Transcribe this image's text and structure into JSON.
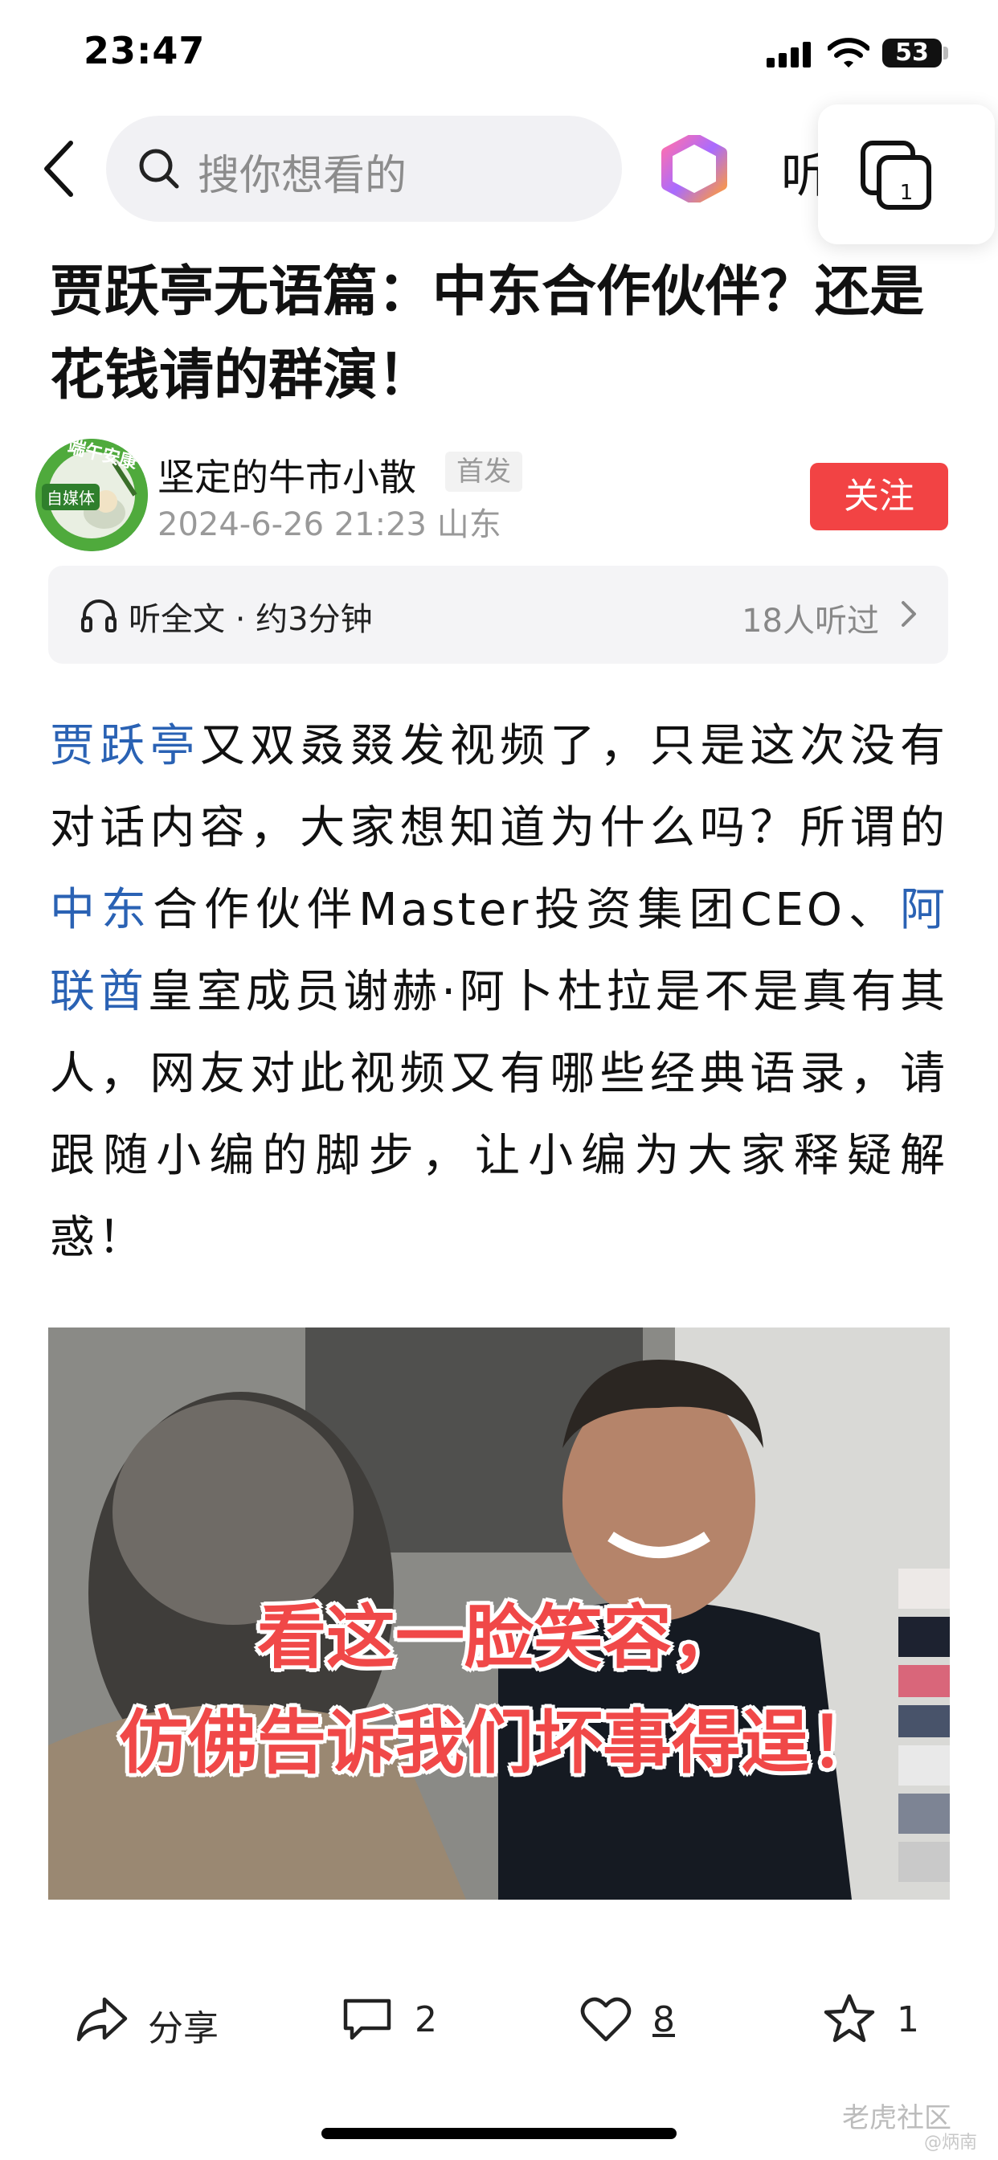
{
  "status_bar": {
    "time": "23:47",
    "battery": "53"
  },
  "nav": {
    "search_placeholder": "搜你想看的",
    "listen_label": "听",
    "tabs_count": "1"
  },
  "article": {
    "title": "贾跃亭无语篇：中东合作伙伴？还是花钱请的群演！",
    "author": {
      "name": "坚定的牛市小散",
      "badge": "首发",
      "meta": "2024-6-26 21:23 山东",
      "avatar_text_top": "端午安康",
      "avatar_text_mid": "自媒体"
    },
    "follow_label": "关注",
    "listen_bar": {
      "label": "听全文 · 约3分钟",
      "count": "18人听过"
    },
    "body": {
      "kw1": "贾跃亭",
      "t1": "又双叒叕发视频了，只是这次没有对话内容，大家想知道为什么吗？所谓的",
      "kw2": "中东",
      "t2": "合作伙伴Master投资集团CEO、",
      "kw3": "阿联酋",
      "t3": "皇室成员谢赫·阿卜杜拉是不是真有其人，网友对此视频又有哪些经典语录，请跟随小编的脚步，让小编为大家释疑解惑！"
    },
    "image_caption_1": "看这一脸笑容，",
    "image_caption_2": "仿佛告诉我们坏事得逞！"
  },
  "bottom_bar": {
    "share_label": "分享",
    "comments": "2",
    "likes": "8",
    "favorites": "1"
  },
  "watermark": {
    "text": "老虎社区",
    "sub": "@炳南"
  },
  "colors": {
    "accent": "#f24344",
    "link": "#2a62b4"
  }
}
